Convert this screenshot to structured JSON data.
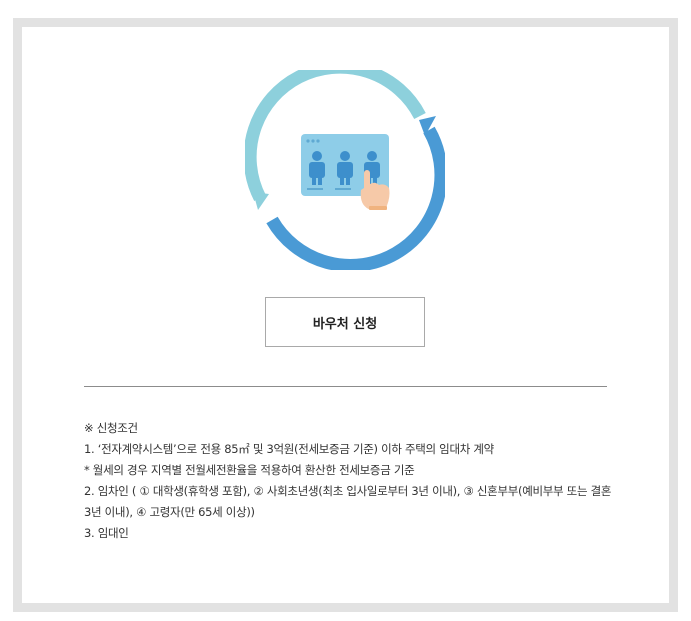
{
  "apply_button": {
    "label": "바우처 신청"
  },
  "conditions": {
    "heading": "※ 신청조건",
    "item1": "1. ‘전자계약시스템’으로 전용 85㎡ 및 3억원(전세보증금 기준) 이하 주택의 임대차 계약",
    "item1_note": "* 월세의 경우 지역별 전월세전환율을 적용하여 환산한 전세보증금 기준",
    "item2": "2. 임차인 ( ① 대학생(휴학생 포함), ② 사회초년생(최초 입사일로부터 3년 이내), ③ 신혼부부(예비부부 또는 결혼 3년 이내), ④ 고령자(만 65세 이상))",
    "item3": "3. 임대인"
  },
  "colors": {
    "ring_light": "#8dd0dc",
    "ring_dark": "#4a9ad5",
    "panel": "#8ecde8",
    "frame": "#e2e2e2"
  },
  "icons": [
    "circular-arrows-icon",
    "contract-people-icon",
    "touch-hand-icon"
  ]
}
